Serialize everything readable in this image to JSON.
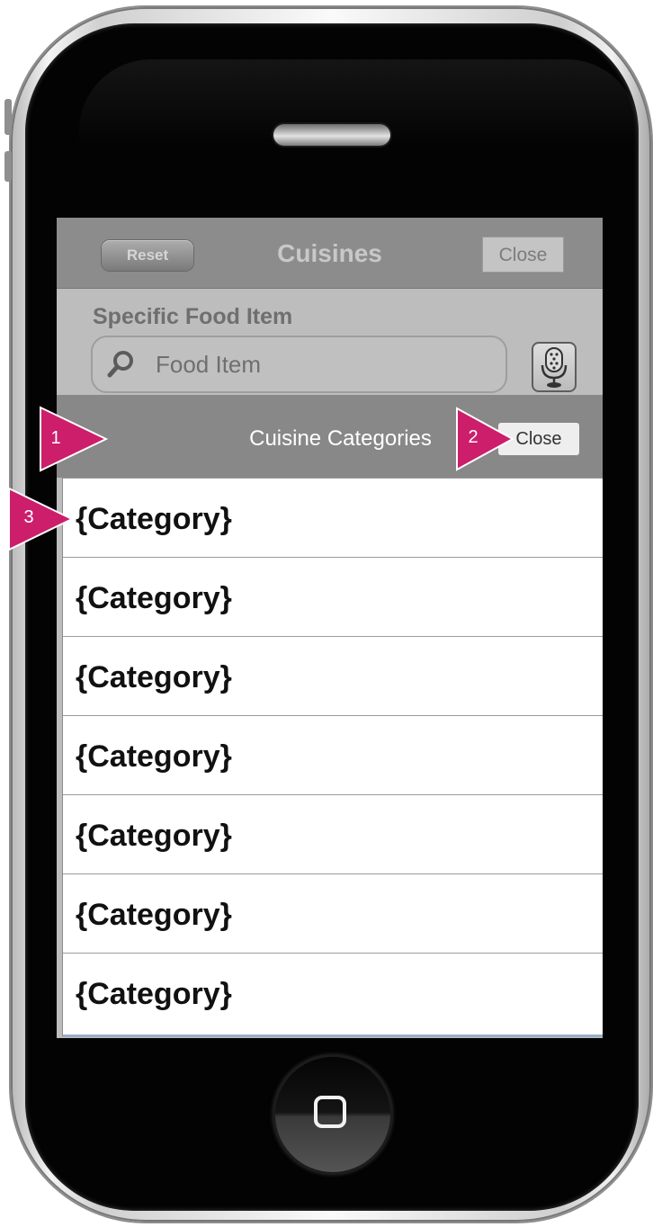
{
  "navbar": {
    "title": "Cuisines",
    "reset_label": "Reset",
    "close_label": "Close"
  },
  "food_search": {
    "label": "Specific Food Item",
    "placeholder": "Food Item"
  },
  "sheet": {
    "title": "Cuisine Categories",
    "close_label": "Close"
  },
  "categories": [
    "{Category}",
    "{Category}",
    "{Category}",
    "{Category}",
    "{Category}",
    "{Category}",
    "{Category}"
  ],
  "annotations": [
    "1",
    "2",
    "3"
  ],
  "colors": {
    "annotation_marker": "#cc1e6b",
    "sheet_header": "#888888",
    "screen_dim": "#bdbdbd"
  },
  "icons": [
    "search-icon",
    "microphone-icon",
    "home-button-icon",
    "speaker-icon"
  ]
}
